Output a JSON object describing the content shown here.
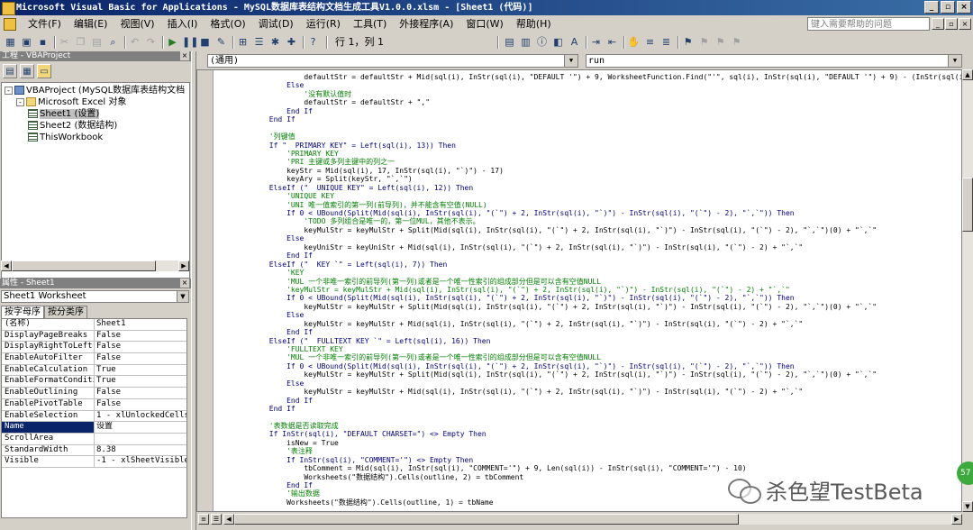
{
  "window": {
    "title": "Microsoft Visual Basic for Applications - MySQL数据库表结构文档生成工具V1.0.0.xlsm - [Sheet1 (代码)]",
    "controls": [
      "_",
      "▫",
      "×"
    ]
  },
  "menu": {
    "items": [
      "文件(F)",
      "编辑(E)",
      "视图(V)",
      "插入(I)",
      "格式(O)",
      "调试(D)",
      "运行(R)",
      "工具(T)",
      "外接程序(A)",
      "窗口(W)",
      "帮助(H)"
    ],
    "help_placeholder": "键入需要帮助的问题",
    "mdi_controls": [
      "_",
      "▫",
      "×"
    ]
  },
  "toolbar": {
    "position": "行 1，列 1"
  },
  "project": {
    "header": "工程 - VBAProject",
    "tree": [
      {
        "level": 0,
        "expander": "-",
        "icon": "proj",
        "label": "VBAProject (MySQL数据库表结构文档"
      },
      {
        "level": 1,
        "expander": "-",
        "icon": "folder",
        "label": "Microsoft Excel 对象"
      },
      {
        "level": 2,
        "expander": "",
        "icon": "sheet",
        "label": "Sheet1 (设置)"
      },
      {
        "level": 2,
        "expander": "",
        "icon": "sheet",
        "label": "Sheet2 (数据结构)"
      },
      {
        "level": 2,
        "expander": "",
        "icon": "sheet",
        "label": "ThisWorkbook"
      }
    ]
  },
  "properties": {
    "header": "属性 - Sheet1",
    "object": "Sheet1 Worksheet",
    "tabs": [
      "按字母序",
      "按分类序"
    ],
    "rows": [
      {
        "name": "(名称)",
        "value": "Sheet1"
      },
      {
        "name": "DisplayPageBreaks",
        "value": "False"
      },
      {
        "name": "DisplayRightToLeft",
        "value": "False"
      },
      {
        "name": "EnableAutoFilter",
        "value": "False"
      },
      {
        "name": "EnableCalculation",
        "value": "True"
      },
      {
        "name": "EnableFormatConditions",
        "value": "True"
      },
      {
        "name": "EnableOutlining",
        "value": "False"
      },
      {
        "name": "EnablePivotTable",
        "value": "False"
      },
      {
        "name": "EnableSelection",
        "value": "1 - xlUnlockedCells"
      },
      {
        "name": "Name",
        "value": "设置"
      },
      {
        "name": "ScrollArea",
        "value": ""
      },
      {
        "name": "StandardWidth",
        "value": "8.38"
      },
      {
        "name": "Visible",
        "value": "-1 - xlSheetVisible"
      }
    ]
  },
  "code": {
    "object_combo": "(通用)",
    "proc_combo": "run",
    "lines": [
      {
        "t": "                    defaultStr = defaultStr + Mid(sql(i), InStr(sql(i), \"DEFAULT '\") + 9, WorksheetFunction.Find(\"'\", sql(i), InStr(sql(i), \"DEFAULT '\") + 9) - (InStr(sql(i), \"DE",
        "c": "code"
      },
      {
        "t": "                Else",
        "c": "kw"
      },
      {
        "t": "                    '没有默认值时",
        "c": "cm"
      },
      {
        "t": "                    defaultStr = defaultStr + \",\"",
        "c": "code"
      },
      {
        "t": "                End If",
        "c": "kw"
      },
      {
        "t": "            End If",
        "c": "kw"
      },
      {
        "t": "",
        "c": "code"
      },
      {
        "t": "            '列键值",
        "c": "cm"
      },
      {
        "t": "            If \"  PRIMARY KEY\" = Left(sql(i), 13)) Then",
        "c": "kw"
      },
      {
        "t": "                'PRIMARY KEY",
        "c": "cm"
      },
      {
        "t": "                'PRI 主键或多列主键中的列之一",
        "c": "cm"
      },
      {
        "t": "                keyStr = Mid(sql(i), 17, InStr(sql(i), \"`)\") - 17)",
        "c": "code"
      },
      {
        "t": "                keyAry = Split(keyStr, \"`,`\")",
        "c": "code"
      },
      {
        "t": "            ElseIf (\"  UNIQUE KEY\" = Left(sql(i), 12)) Then",
        "c": "kw"
      },
      {
        "t": "                'UNIQUE KEY",
        "c": "cm"
      },
      {
        "t": "                'UNI 唯一值索引的第一列(前导列)，并不能含有空值(NULL)",
        "c": "cm"
      },
      {
        "t": "                If 0 < UBound(Split(Mid(sql(i), InStr(sql(i), \"(`\") + 2, InStr(sql(i), \"`)\") - InStr(sql(i), \"(`\") - 2), \"`,`\")) Then",
        "c": "kw"
      },
      {
        "t": "                    'TODO 多列组合是唯一的，第一位MUL，其他不表示。",
        "c": "cm"
      },
      {
        "t": "                    keyMulStr = keyMulStr + Split(Mid(sql(i), InStr(sql(i), \"(`\") + 2, InStr(sql(i), \"`)\") - InStr(sql(i), \"(`\") - 2), \"`,`\")(0) + \"`,`\"",
        "c": "code"
      },
      {
        "t": "                Else",
        "c": "kw"
      },
      {
        "t": "                    keyUniStr = keyUniStr + Mid(sql(i), InStr(sql(i), \"(`\") + 2, InStr(sql(i), \"`)\") - InStr(sql(i), \"(`\") - 2) + \"`,`\"",
        "c": "code"
      },
      {
        "t": "                End If",
        "c": "kw"
      },
      {
        "t": "            ElseIf (\"  KEY `\" = Left(sql(i), 7)) Then",
        "c": "kw"
      },
      {
        "t": "                'KEY",
        "c": "cm"
      },
      {
        "t": "                'MUL 一个非唯一索引的前导列(第一列)或者是一个唯一性索引的组成部分但是可以含有空值NULL",
        "c": "cm"
      },
      {
        "t": "                'keyMulStr = keyMulStr + Mid(sql(i), InStr(sql(i), \"(`\") + 2, InStr(sql(i), \"`)\") - InStr(sql(i), \"(`\") - 2) + \"`,`\"",
        "c": "cm"
      },
      {
        "t": "                If 0 < UBound(Split(Mid(sql(i), InStr(sql(i), \"(`\") + 2, InStr(sql(i), \"`)\") - InStr(sql(i), \"(`\") - 2), \"`,`\")) Then",
        "c": "kw"
      },
      {
        "t": "                    keyMulStr = keyMulStr + Split(Mid(sql(i), InStr(sql(i), \"(`\") + 2, InStr(sql(i), \"`)\") - InStr(sql(i), \"(`\") - 2), \"`,`\")(0) + \"`,`\"",
        "c": "code"
      },
      {
        "t": "                Else",
        "c": "kw"
      },
      {
        "t": "                    keyMulStr = keyMulStr + Mid(sql(i), InStr(sql(i), \"(`\") + 2, InStr(sql(i), \"`)\") - InStr(sql(i), \"(`\") - 2) + \"`,`\"",
        "c": "code"
      },
      {
        "t": "                End If",
        "c": "kw"
      },
      {
        "t": "            ElseIf (\"  FULLTEXT KEY `\" = Left(sql(i), 16)) Then",
        "c": "kw"
      },
      {
        "t": "                'FULLTEXT KEY",
        "c": "cm"
      },
      {
        "t": "                'MUL 一个非唯一索引的前导列(第一列)或者是一个唯一性索引的组成部分但是可以含有空值NULL",
        "c": "cm"
      },
      {
        "t": "                If 0 < UBound(Split(Mid(sql(i), InStr(sql(i), \"(`\") + 2, InStr(sql(i), \"`)\") - InStr(sql(i), \"(`\") - 2), \"`,`\")) Then",
        "c": "kw"
      },
      {
        "t": "                    keyMulStr = keyMulStr + Split(Mid(sql(i), InStr(sql(i), \"(`\") + 2, InStr(sql(i), \"`)\") - InStr(sql(i), \"(`\") - 2), \"`,`\")(0) + \"`,`\"",
        "c": "code"
      },
      {
        "t": "                Else",
        "c": "kw"
      },
      {
        "t": "                    keyMulStr = keyMulStr + Mid(sql(i), InStr(sql(i), \"(`\") + 2, InStr(sql(i), \"`)\") - InStr(sql(i), \"(`\") - 2) + \"`,`\"",
        "c": "code"
      },
      {
        "t": "                End If",
        "c": "kw"
      },
      {
        "t": "            End If",
        "c": "kw"
      },
      {
        "t": "",
        "c": "code"
      },
      {
        "t": "            '表数据是否读取完成",
        "c": "cm"
      },
      {
        "t": "            If InStr(sql(i), \"DEFAULT CHARSET=\") <> Empty Then",
        "c": "kw"
      },
      {
        "t": "                isNew = True",
        "c": "code"
      },
      {
        "t": "                '表注释",
        "c": "cm"
      },
      {
        "t": "                If InStr(sql(i), \"COMMENT='\") <> Empty Then",
        "c": "kw"
      },
      {
        "t": "                    tbComment = Mid(sql(i), InStr(sql(i), \"COMMENT='\") + 9, Len(sql(i)) - InStr(sql(i), \"COMMENT='\") - 10)",
        "c": "code"
      },
      {
        "t": "                    Worksheets(\"数据结构\").Cells(outline, 2) = tbComment",
        "c": "code"
      },
      {
        "t": "                End If",
        "c": "kw"
      },
      {
        "t": "                '输出数据",
        "c": "cm"
      },
      {
        "t": "                Worksheets(\"数据结构\").Cells(outline, 1) = tbName",
        "c": "code"
      }
    ]
  },
  "watermark": {
    "text": "杀色望TestBeta"
  },
  "badge": {
    "text": "57"
  }
}
